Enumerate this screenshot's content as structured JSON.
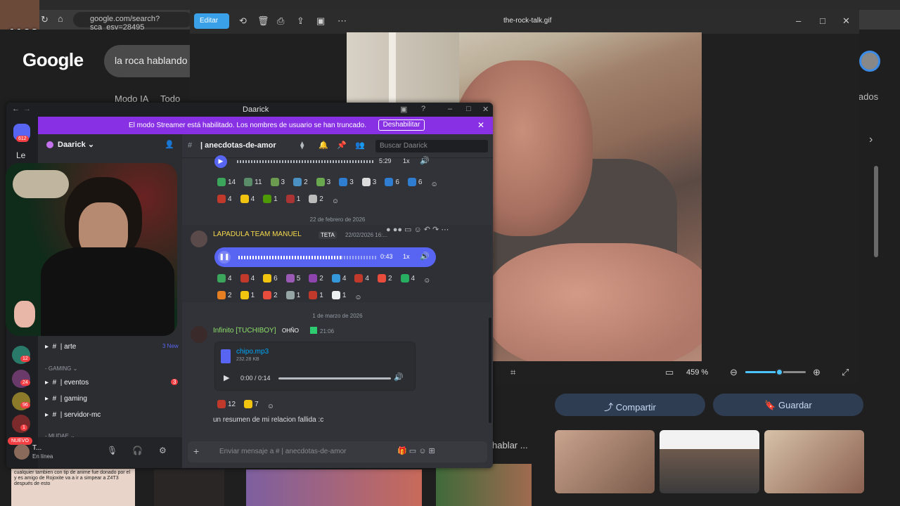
{
  "browser": {
    "url": "google.com/search?sca_esv=28495",
    "streamer_tag": "x1163"
  },
  "google": {
    "logo": "Google",
    "query": "la roca hablando",
    "tabs": [
      "Modo IA",
      "Todo"
    ],
    "right_label": "lados",
    "share_label": "Compartir",
    "save_label": "Guardar",
    "habla_label": "hablar ...",
    "thumb_caption": "cualquier tambien con tip de anime fue donado por el y es amigo de Rojoxite va a ir a simpear a Z4T3 después de esto"
  },
  "viewer": {
    "edit_label": "Editar",
    "title": "the-rock-talk.gif",
    "zoom": "459 %",
    "zoom_fraction": 0.56
  },
  "discord": {
    "window_title": "Daarick",
    "streamer_banner": "El modo Streamer está habilitado. Los nombres de usuario se han truncado.",
    "streamer_button": "Deshabilitar",
    "server_name": "Daarick",
    "server_badge": "612",
    "sidebar_le": "Le",
    "channel_name": "anecdotas-de-amor",
    "search_placeholder": "Buscar Daarick",
    "channels": {
      "arte": {
        "name": "arte",
        "badge": "3 New"
      },
      "category": "GAMING",
      "eventos": {
        "name": "eventos",
        "badge": "3"
      },
      "gaming": {
        "name": "gaming"
      },
      "servidor": {
        "name": "servidor-mc"
      },
      "category2": "MUDAE"
    },
    "guild_badges": [
      "12",
      "24",
      "96",
      "1"
    ],
    "nuevo": "NUEVO",
    "first_audio": {
      "time": "5:29",
      "speed": "1x"
    },
    "reactions_row1": [
      [
        "14",
        "#3ba55c"
      ],
      [
        "11",
        "#5b8c6a"
      ],
      [
        "3",
        "#6a9b4f"
      ],
      [
        "2",
        "#4a90c2"
      ],
      [
        "3",
        "#6aa84f"
      ],
      [
        "3",
        "#2f7dd1"
      ],
      [
        "3",
        "#dcdcdc"
      ],
      [
        "6",
        "#2f7dd1"
      ],
      [
        "6",
        "#2f7dd1"
      ]
    ],
    "reactions_row2": [
      [
        "4",
        "#c0392b"
      ],
      [
        "4",
        "#f1c40f"
      ],
      [
        "1",
        "#4e9a06"
      ],
      [
        "1",
        "#a33"
      ],
      [
        "2",
        "#bbb"
      ]
    ],
    "date1": "22 de febrero de 2026",
    "msg1": {
      "author": "LAPADULA TEAM MANUEL",
      "tag": "TETA",
      "time": "22/02/2026 16:...",
      "audio_time": "0:43",
      "speed": "1x"
    },
    "reactions_row3": [
      [
        "4",
        "#3ba55c"
      ],
      [
        "4",
        "#c0392b"
      ],
      [
        "6",
        "#f1c40f"
      ],
      [
        "5",
        "#9b59b6"
      ],
      [
        "2",
        "#8e44ad"
      ],
      [
        "4",
        "#3498db"
      ],
      [
        "4",
        "#c0392b"
      ],
      [
        "2",
        "#e74c3c"
      ],
      [
        "4",
        "#27ae60"
      ]
    ],
    "reactions_row4": [
      [
        "2",
        "#e67e22"
      ],
      [
        "1",
        "#f1c40f"
      ],
      [
        "2",
        "#e74c3c"
      ],
      [
        "1",
        "#95a5a6"
      ],
      [
        "1",
        "#c0392b"
      ],
      [
        "1",
        "#ecf0f1"
      ]
    ],
    "date2": "1 de marzo de 2026",
    "msg2": {
      "author": "Infinito [TUCHIBOY]",
      "tag": "OHÑO",
      "time": "21:06",
      "file_name": "chipo.mp3",
      "file_size": "232.28 KB",
      "audio_time": "0:00 / 0:14",
      "text": "un resumen de mi relacion fallida :c"
    },
    "reactions_row5": [
      [
        "12",
        "#c0392b"
      ],
      [
        "7",
        "#f1c40f"
      ]
    ],
    "user": {
      "name": "T...",
      "status": "En línea"
    },
    "input_placeholder": "Enviar mensaje a # | anecdotas-de-amor"
  }
}
